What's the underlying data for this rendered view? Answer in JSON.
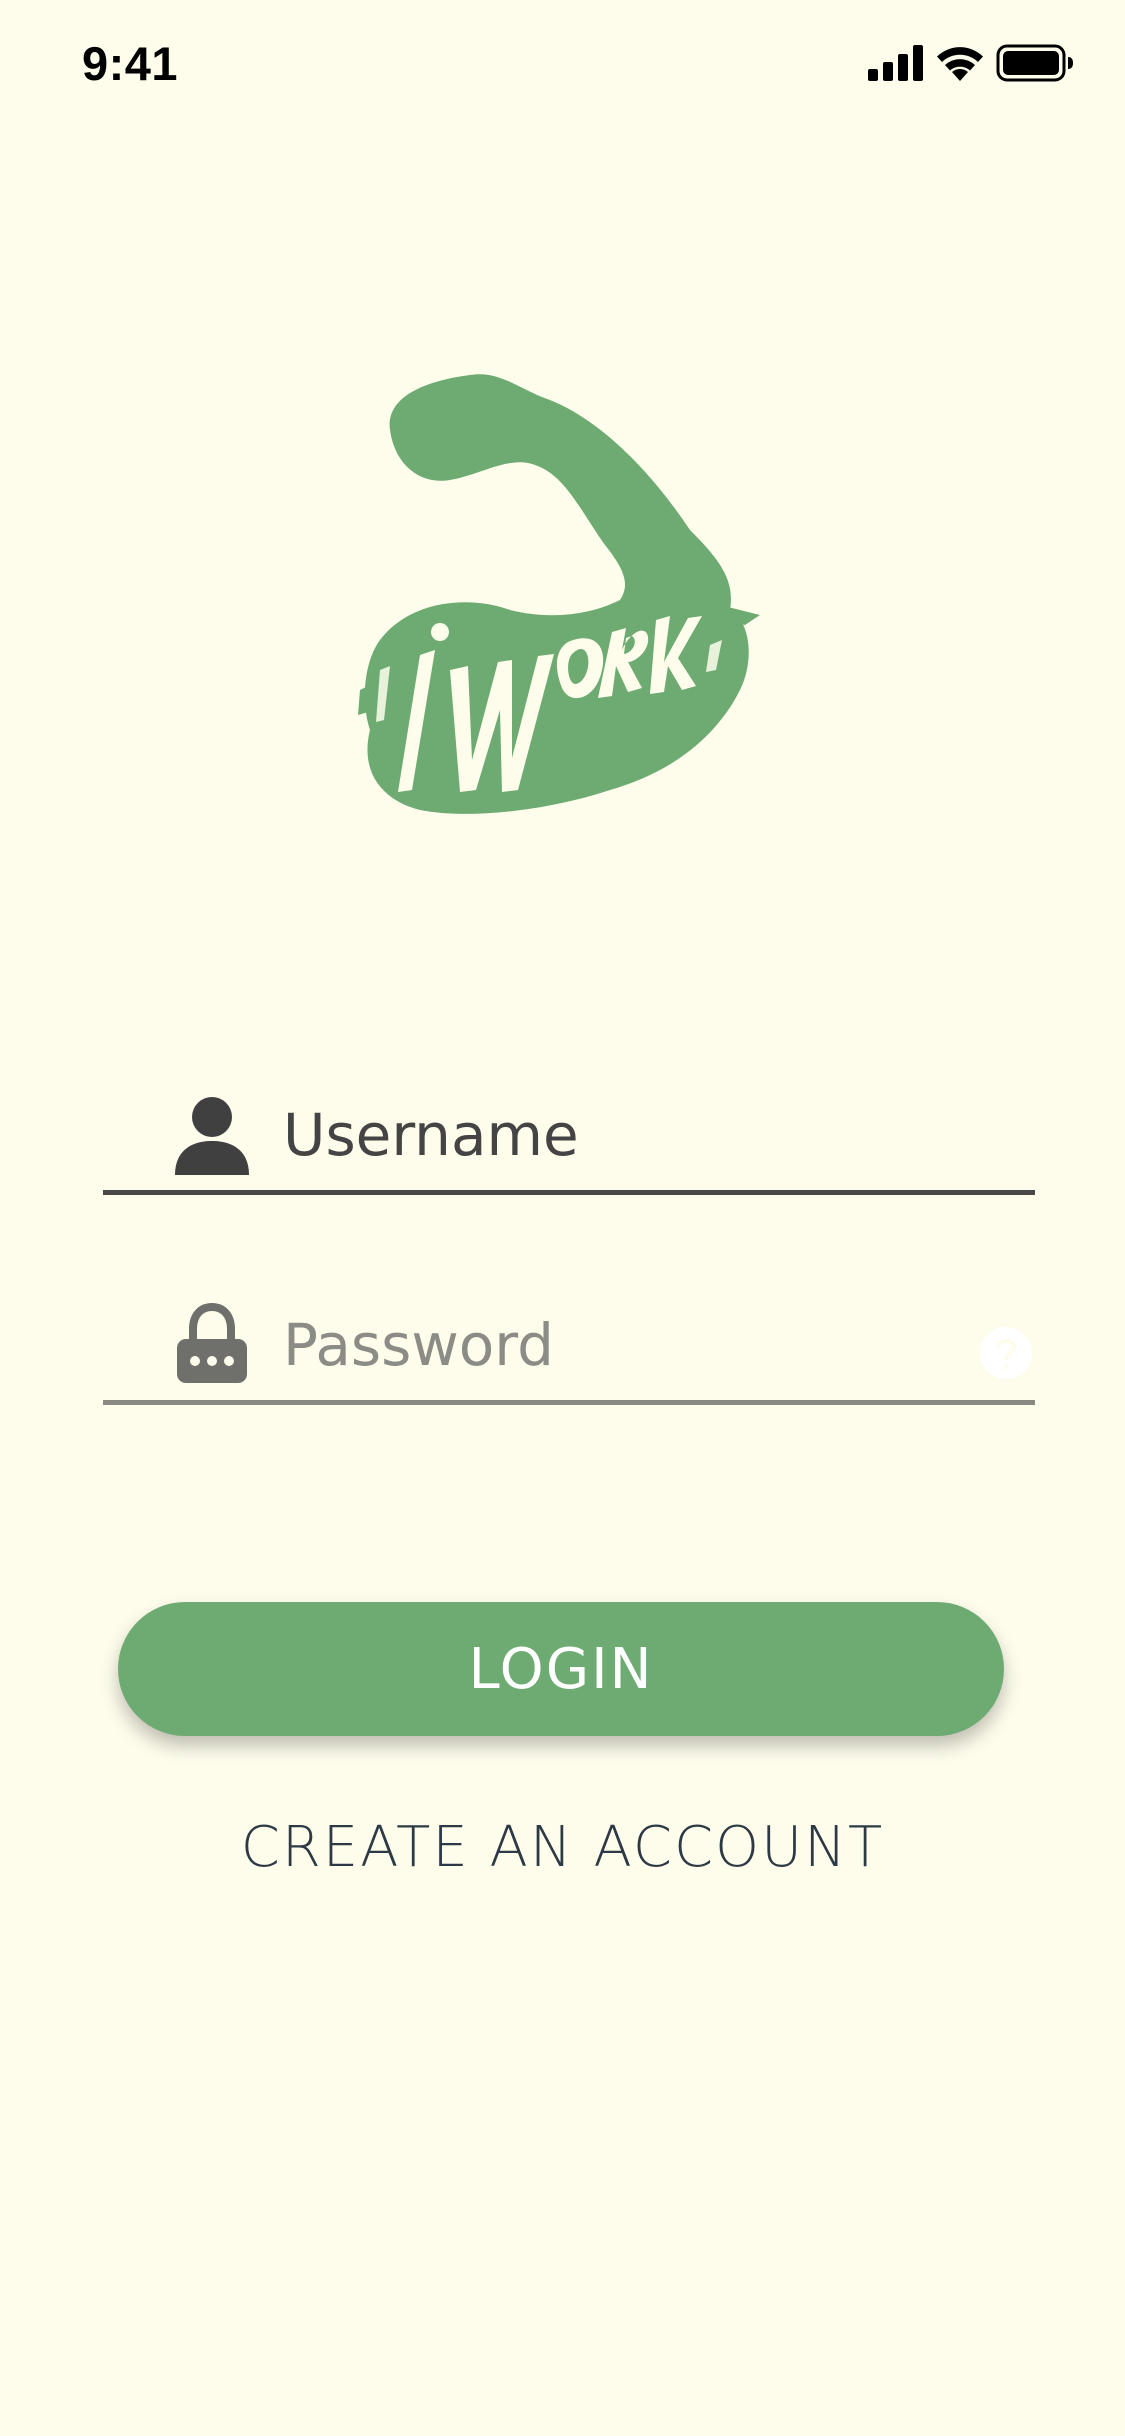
{
  "status_bar": {
    "time": "9:41"
  },
  "logo": {
    "text": "iWork",
    "color": "#6eab73"
  },
  "form": {
    "username": {
      "placeholder": "Username",
      "value": "",
      "icon": "user-icon"
    },
    "password": {
      "placeholder": "Password",
      "value": "",
      "icon": "lock-icon",
      "help_icon": "help-icon"
    }
  },
  "actions": {
    "login_label": "LOGIN",
    "create_account_label": "CREATE AN ACCOUNT"
  },
  "colors": {
    "background": "#fefdec",
    "accent": "#6eab73",
    "text_dark": "#444444",
    "text_muted": "#8c8c86",
    "link": "#2d3a45"
  }
}
